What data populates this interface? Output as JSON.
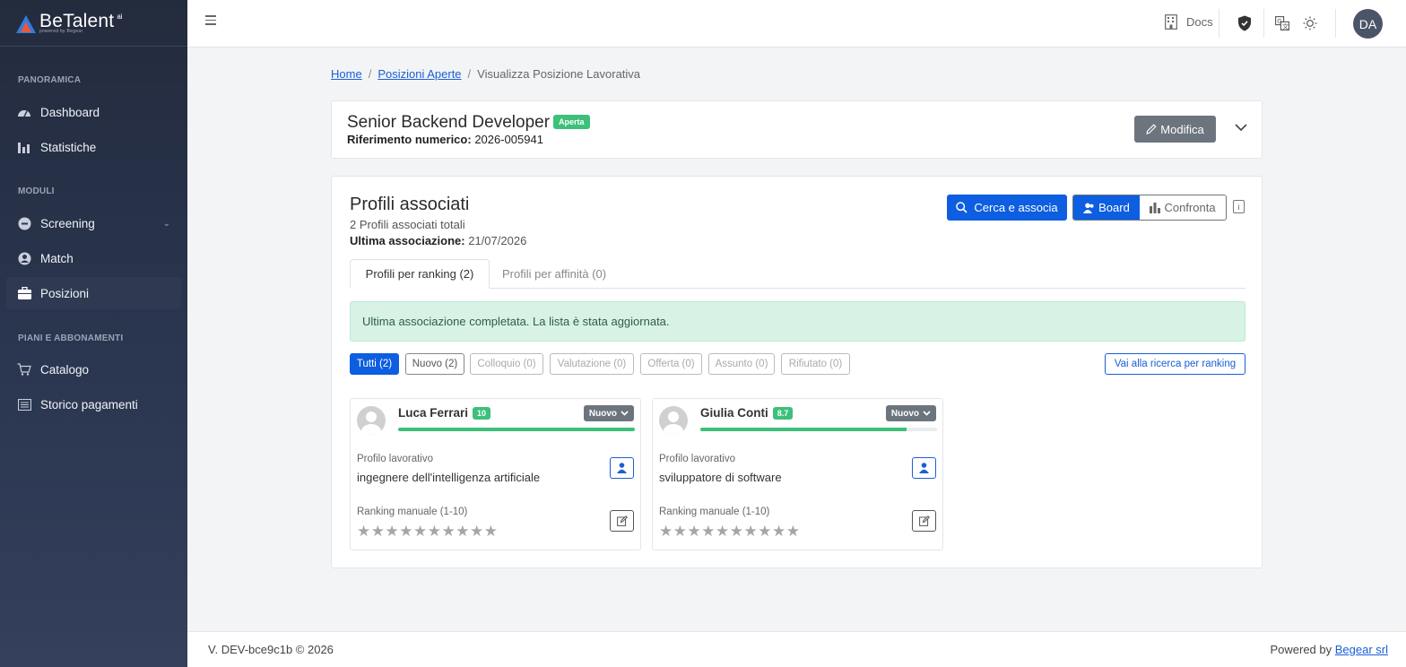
{
  "brand": {
    "name": "BeTalent",
    "sub": "powered by Begear",
    "ai": "ai"
  },
  "sidebar": {
    "sections": [
      {
        "title": "PANORAMICA"
      },
      {
        "title": "MODULI"
      },
      {
        "title": "PIANI E ABBONAMENTI"
      }
    ],
    "items": [
      {
        "label": "Dashboard",
        "icon": "gauge-icon"
      },
      {
        "label": "Statistiche",
        "icon": "bar-chart-icon"
      },
      {
        "label": "Screening",
        "icon": "screening-icon"
      },
      {
        "label": "Match",
        "icon": "user-circle-icon"
      },
      {
        "label": "Posizioni",
        "icon": "briefcase-icon",
        "active": true
      },
      {
        "label": "Catalogo",
        "icon": "cart-icon"
      },
      {
        "label": "Storico pagamenti",
        "icon": "receipt-icon"
      }
    ]
  },
  "topbar": {
    "docs_label": "Docs",
    "avatar_initials": "DA"
  },
  "breadcrumb": {
    "home": "Home",
    "open_positions": "Posizioni Aperte",
    "current": "Visualizza Posizione Lavorativa"
  },
  "position": {
    "title": "Senior Backend Developer",
    "status": "Aperta",
    "ref_label": "Riferimento numerico:",
    "ref_value": "2026-005941",
    "edit_label": "Modifica"
  },
  "profiles": {
    "title": "Profili associati",
    "total": "2 Profili associati totali",
    "last_label": "Ultima associazione:",
    "last_value": "21/07/2026",
    "search_button": "Cerca e associa",
    "view_board": "Board",
    "view_compare": "Confronta",
    "tabs": [
      "Profili per ranking (2)",
      "Profili per affinità (0)"
    ],
    "alert": "Ultima associazione completata. La lista è stata aggiornata.",
    "filters": [
      "Tutti (2)",
      "Nuovo (2)",
      "Colloquio (0)",
      "Valutazione (0)",
      "Offerta (0)",
      "Assunto (0)",
      "Rifiutato (0)"
    ],
    "ranking_button": "Vai alla ricerca per ranking",
    "job_profile_label": "Profilo lavorativo",
    "manual_ranking_label": "Ranking manuale (1-10)",
    "cards": [
      {
        "name": "Luca Ferrari",
        "score": "10",
        "score_fraction": 1.0,
        "status": "Nuovo",
        "job": "ingegnere dell'intelligenza artificiale"
      },
      {
        "name": "Giulia Conti",
        "score": "8.7",
        "score_fraction": 0.87,
        "status": "Nuovo",
        "job": "sviluppatore di software"
      }
    ]
  },
  "footer": {
    "version": "V. DEV-bce9c1b © 2026",
    "powered": "Powered by",
    "company": "Begear srl"
  },
  "colors": {
    "primary": "#0d5ee0",
    "success": "#3cc07a",
    "sidebar": "#2b3650"
  }
}
